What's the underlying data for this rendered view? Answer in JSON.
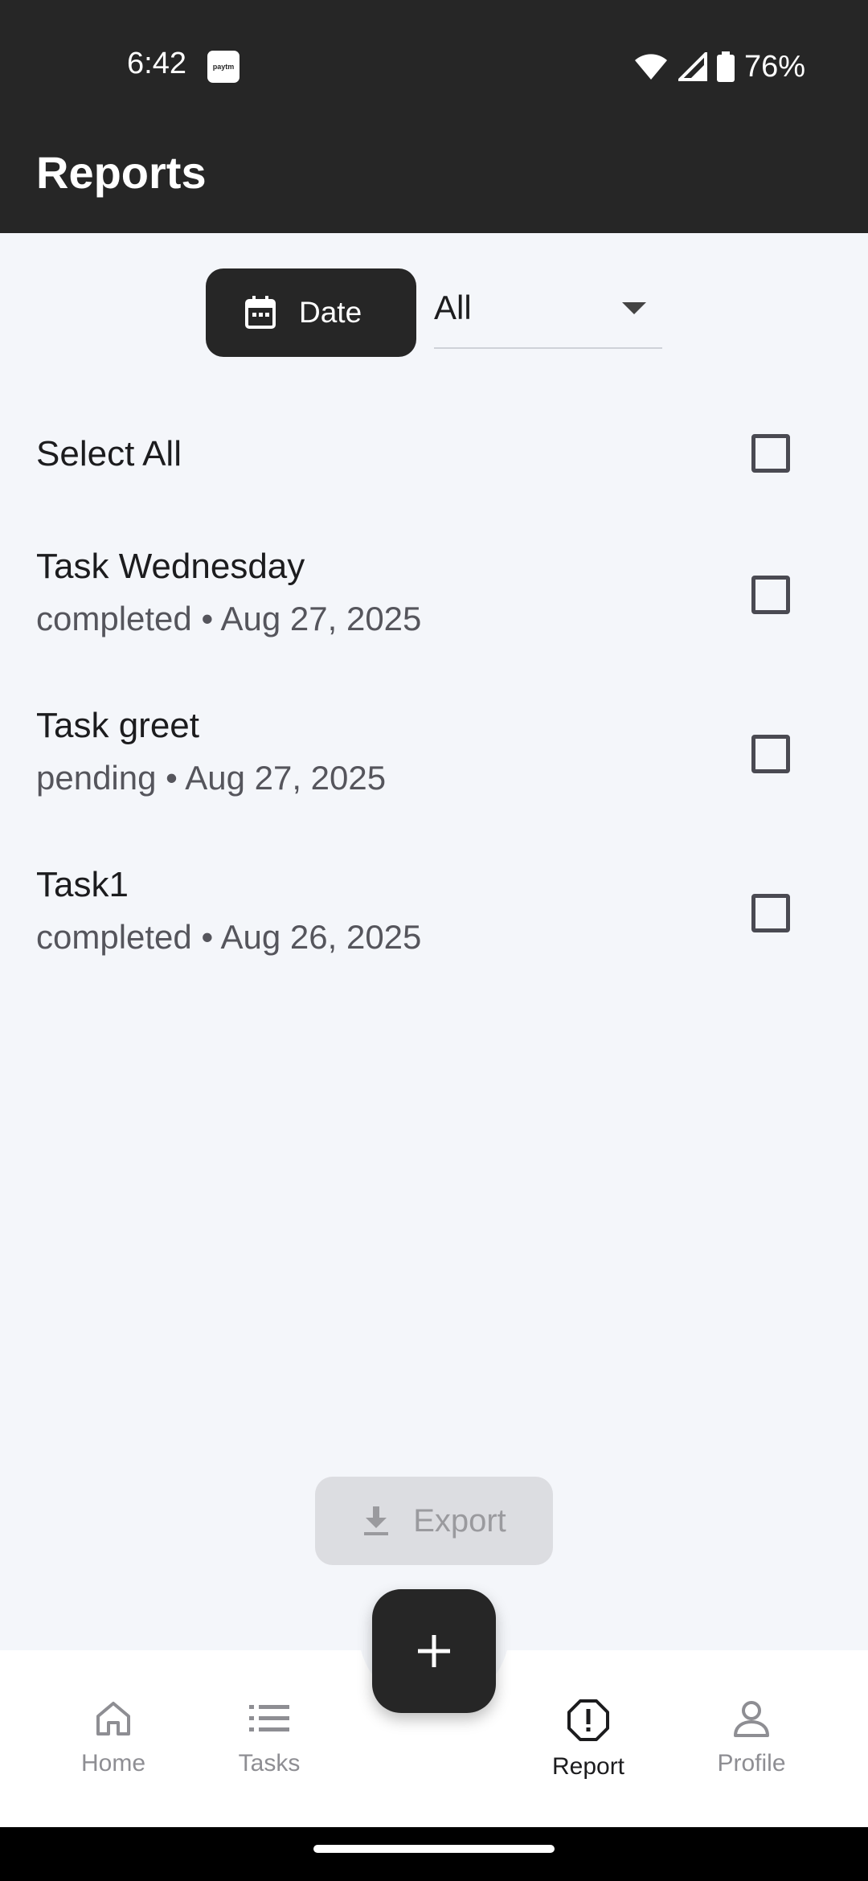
{
  "status_bar": {
    "time": "6:42",
    "notification_icon": "paytm-icon",
    "paytm_text": "paytm",
    "battery_percent": "76%"
  },
  "header": {
    "title": "Reports"
  },
  "filters": {
    "date_button_label": "Date",
    "status_select_value": "All"
  },
  "select_all_label": "Select All",
  "tasks": [
    {
      "title": "Task Wednesday",
      "subtitle": "completed • Aug 27, 2025"
    },
    {
      "title": "Task greet",
      "subtitle": "pending • Aug 27, 2025"
    },
    {
      "title": "Task1",
      "subtitle": "completed • Aug 26, 2025"
    }
  ],
  "export_label": "Export",
  "bottom_nav": {
    "items": [
      {
        "label": "Home",
        "icon": "home-icon"
      },
      {
        "label": "Tasks",
        "icon": "list-icon"
      },
      {
        "label": "Report",
        "icon": "report-icon",
        "active": true
      },
      {
        "label": "Profile",
        "icon": "person-icon"
      }
    ]
  },
  "colors": {
    "app_bar": "#262626",
    "background": "#f4f6fa",
    "accent": "#262626"
  }
}
